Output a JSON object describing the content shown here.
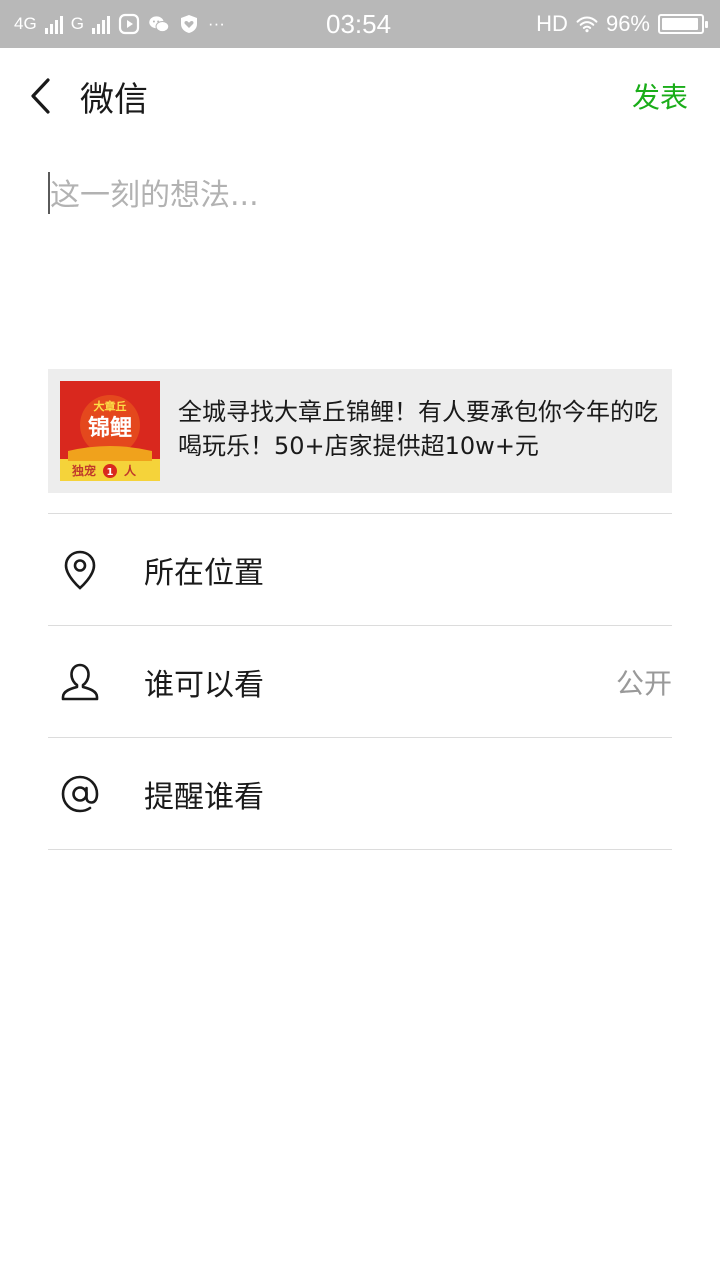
{
  "status_bar": {
    "network_4g": "4G",
    "network_g": "G",
    "dots": "···",
    "time": "03:54",
    "hd": "HD",
    "battery": "96%",
    "battery_level": 0.96
  },
  "nav": {
    "back_icon": "chevron-left-icon",
    "title": "微信",
    "publish_label": "发表",
    "accent_color": "#1aad19"
  },
  "composer": {
    "placeholder": "这一刻的想法..."
  },
  "link_card": {
    "thumb_top_text": "大章丘",
    "thumb_main_text": "锦鲤",
    "thumb_bottom_text": "独宠",
    "thumb_badge": "1",
    "thumb_bottom_suffix": "人",
    "text": "全城寻找大章丘锦鲤！有人要承包你今年的吃喝玩乐！50+店家提供超10w+元"
  },
  "options": [
    {
      "icon": "location-pin-icon",
      "label": "所在位置",
      "value": ""
    },
    {
      "icon": "person-icon",
      "label": "谁可以看",
      "value": "公开"
    },
    {
      "icon": "at-sign-icon",
      "label": "提醒谁看",
      "value": ""
    }
  ]
}
